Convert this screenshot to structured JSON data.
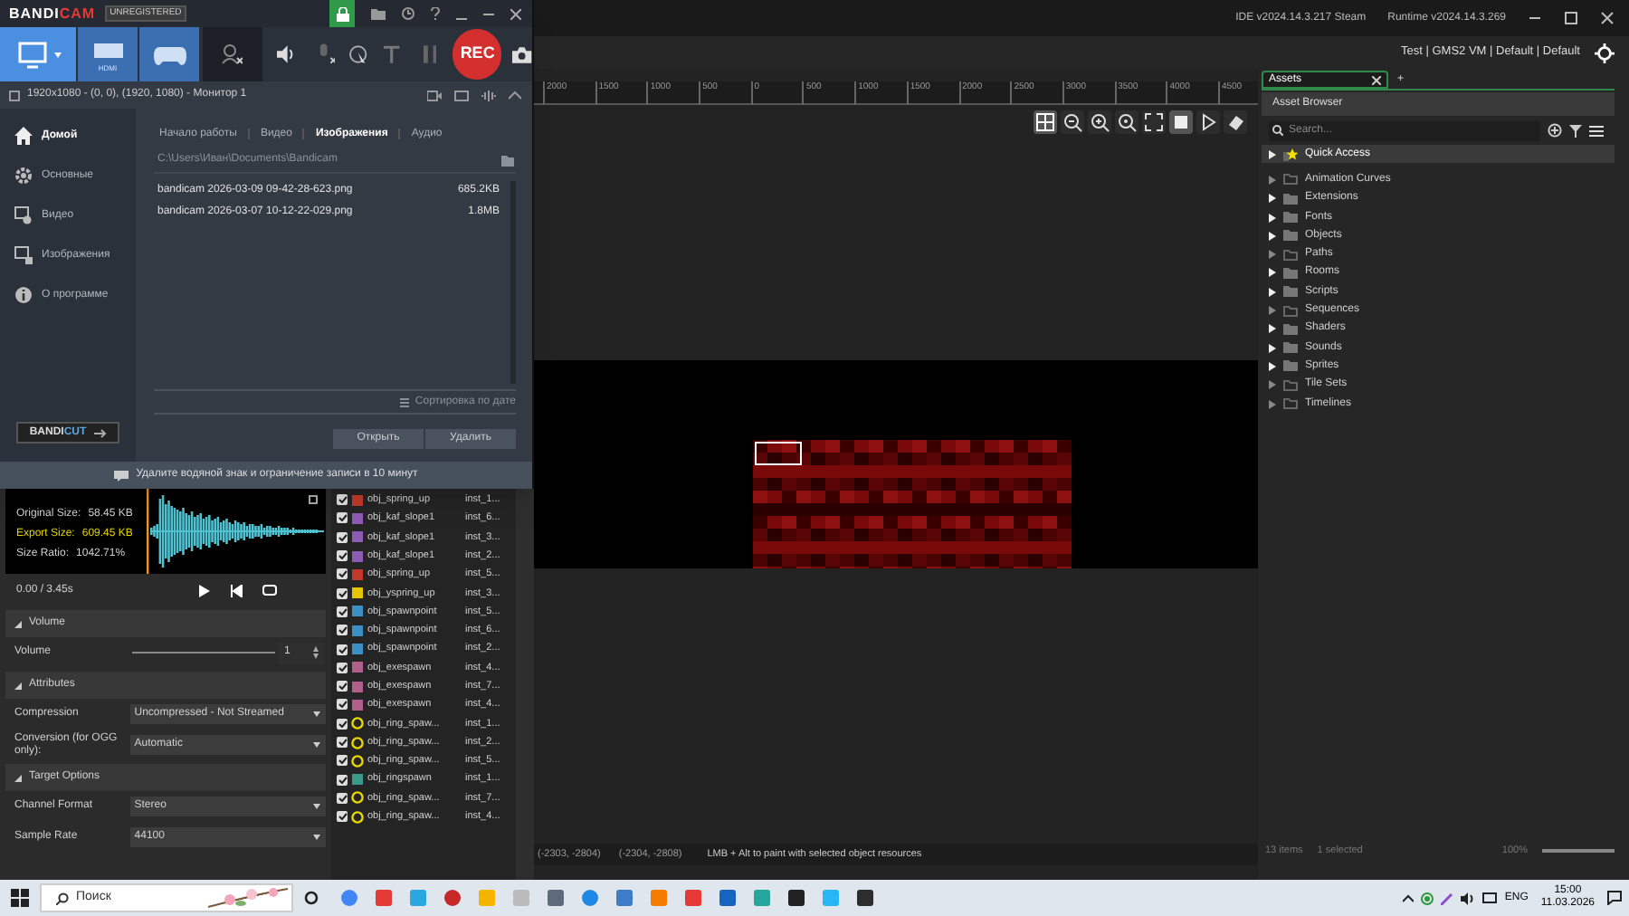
{
  "bandicam": {
    "logo_left": "BANDI",
    "logo_right": "CAM",
    "badge": "UNREGISTERED",
    "rec": "REC",
    "hdmi": "HDMI",
    "modes": [
      {
        "kind": "screen",
        "selected": true
      },
      {
        "kind": "hdmi",
        "selected": false
      },
      {
        "kind": "game",
        "selected": false
      }
    ],
    "area_checked": false,
    "area": "1920x1080 - (0, 0), (1920, 1080) - Монитор 1",
    "sidebar": [
      {
        "kind": "home",
        "label": "Домой",
        "selected": true
      },
      {
        "kind": "gear",
        "label": "Основные",
        "selected": false
      },
      {
        "kind": "video",
        "label": "Видео",
        "selected": false
      },
      {
        "kind": "image",
        "label": "Изображения",
        "selected": false
      },
      {
        "kind": "info",
        "label": "О программе",
        "selected": false
      }
    ],
    "tabs": [
      {
        "label": "Начало работы",
        "selected": false
      },
      {
        "label": "Видео",
        "selected": false
      },
      {
        "label": "Изображения",
        "selected": true
      },
      {
        "label": "Аудио",
        "selected": false
      }
    ],
    "path": "C:\\Users\\Иван\\Documents\\Bandicam",
    "files": [
      {
        "name": "bandicam 2026-03-09 09-42-28-623.png",
        "size": "685.2KB"
      },
      {
        "name": "bandicam 2026-03-07 10-12-22-029.png",
        "size": "1.8MB"
      }
    ],
    "sort": "Сортировка по дате",
    "buttons": [
      "Открыть",
      "Удалить"
    ],
    "bandicut_left": "BANDI",
    "bandicut_right": "CUT",
    "notice": "Удалите водяной знак и ограничение записи в 10 минут"
  },
  "ide": {
    "version": "IDE v2024.14.3.217 Steam",
    "runtime": "Runtime v2024.14.3.269",
    "targets": "Test | GMS2 VM | Default | Default",
    "sound": {
      "original_label": "Original Size:",
      "original": "58.45 KB",
      "export_label": "Export Size:",
      "export": "609.45 KB",
      "ratio_label": "Size Ratio:",
      "ratio": "1042.71%",
      "time": "0.00 / 3.45s",
      "sections": [
        {
          "title": "Volume",
          "rows": [
            {
              "kind": "slider",
              "label": "Volume",
              "level": 1,
              "value": "1"
            }
          ]
        },
        {
          "title": "Attributes",
          "rows": [
            {
              "kind": "dropdown",
              "label": "Compression",
              "value": "Uncompressed - Not Streamed"
            },
            {
              "kind": "dropdown",
              "label": "Conversion (for OGG only):",
              "value": "Automatic"
            }
          ]
        },
        {
          "title": "Target Options",
          "rows": [
            {
              "kind": "dropdown",
              "label": "Channel Format",
              "value": "Stereo"
            },
            {
              "kind": "dropdown",
              "label": "Sample Rate",
              "value": "44100"
            }
          ]
        }
      ]
    },
    "instances": [
      {
        "kind": "sprite",
        "color": "#c0392b",
        "name": "obj_spring_up",
        "id": "inst_1...",
        "checked": true
      },
      {
        "kind": "sprite",
        "color": "#8e5bb5",
        "name": "obj_kaf_slope1",
        "id": "inst_6...",
        "checked": true
      },
      {
        "kind": "sprite",
        "color": "#8e5bb5",
        "name": "obj_kaf_slope1",
        "id": "inst_3...",
        "checked": true
      },
      {
        "kind": "sprite",
        "color": "#8e5bb5",
        "name": "obj_kaf_slope1",
        "id": "inst_2...",
        "checked": true
      },
      {
        "kind": "sprite",
        "color": "#c0392b",
        "name": "obj_spring_up",
        "id": "inst_5...",
        "checked": true
      },
      {
        "kind": "sprite",
        "color": "#e5c400",
        "name": "obj_yspring_up",
        "id": "inst_3...",
        "checked": true
      },
      {
        "kind": "sprite",
        "color": "#3a8fc4",
        "name": "obj_spawnpoint",
        "id": "inst_5...",
        "checked": true
      },
      {
        "kind": "sprite",
        "color": "#3a8fc4",
        "name": "obj_spawnpoint",
        "id": "inst_6...",
        "checked": true
      },
      {
        "kind": "sprite",
        "color": "#3a8fc4",
        "name": "obj_spawnpoint",
        "id": "inst_2...",
        "checked": true
      },
      {
        "kind": "sprite",
        "color": "#b0608a",
        "name": "obj_exespawn",
        "id": "inst_4...",
        "checked": true
      },
      {
        "kind": "sprite",
        "color": "#b0608a",
        "name": "obj_exespawn",
        "id": "inst_7...",
        "checked": true
      },
      {
        "kind": "sprite",
        "color": "#b0608a",
        "name": "obj_exespawn",
        "id": "inst_4...",
        "checked": true
      },
      {
        "kind": "ring",
        "color": "#e8d800",
        "name": "obj_ring_spaw...",
        "id": "inst_1...",
        "checked": true
      },
      {
        "kind": "ring",
        "color": "#e8d800",
        "name": "obj_ring_spaw...",
        "id": "inst_2...",
        "checked": true
      },
      {
        "kind": "ring",
        "color": "#e8d800",
        "name": "obj_ring_spaw...",
        "id": "inst_5...",
        "checked": true
      },
      {
        "kind": "sprite",
        "color": "#3a9a8a",
        "name": "obj_ringspawn",
        "id": "inst_1...",
        "checked": true
      },
      {
        "kind": "ring",
        "color": "#e8d800",
        "name": "obj_ring_spaw...",
        "id": "inst_7...",
        "checked": true
      },
      {
        "kind": "ring",
        "color": "#e8d800",
        "name": "obj_ring_spaw...",
        "id": "inst_4...",
        "checked": true
      }
    ],
    "ruler": [
      "2000",
      "1500",
      "1000",
      "500",
      "0",
      "500",
      "1000",
      "1500",
      "2000",
      "2500",
      "3000",
      "3500",
      "4000",
      "4500"
    ],
    "status": {
      "pos_1": "(-2303, -2804)",
      "pos_2": "(-2304, -2808)",
      "hint": "LMB + Alt to paint with selected object resources"
    },
    "assets": {
      "tab": "Assets",
      "tab_add": "+",
      "header": "Asset Browser",
      "search_placeholder": "Search...",
      "tree": [
        {
          "kind": "quick",
          "label": "Quick Access",
          "selected": true
        },
        {
          "kind": "empty",
          "label": "Animation Curves",
          "selected": false
        },
        {
          "kind": "folder",
          "label": "Extensions",
          "selected": false
        },
        {
          "kind": "folder",
          "label": "Fonts",
          "selected": false
        },
        {
          "kind": "folder",
          "label": "Objects",
          "selected": false
        },
        {
          "kind": "empty",
          "label": "Paths",
          "selected": false
        },
        {
          "kind": "folder",
          "label": "Rooms",
          "selected": false
        },
        {
          "kind": "folder",
          "label": "Scripts",
          "selected": false
        },
        {
          "kind": "empty",
          "label": "Sequences",
          "selected": false
        },
        {
          "kind": "folder",
          "label": "Shaders",
          "selected": false
        },
        {
          "kind": "folder",
          "label": "Sounds",
          "selected": false
        },
        {
          "kind": "folder",
          "label": "Sprites",
          "selected": false
        },
        {
          "kind": "empty",
          "label": "Tile Sets",
          "selected": false
        },
        {
          "kind": "empty",
          "label": "Timelines",
          "selected": false
        }
      ],
      "items": "13 items",
      "selected_count": "1 selected",
      "zoom": "100%",
      "zoom_slider": {
        "level": 1
      }
    }
  },
  "taskbar": {
    "search_placeholder": "Поиск",
    "lang": "ENG",
    "time": "15:00",
    "date": "11.03.2026"
  }
}
